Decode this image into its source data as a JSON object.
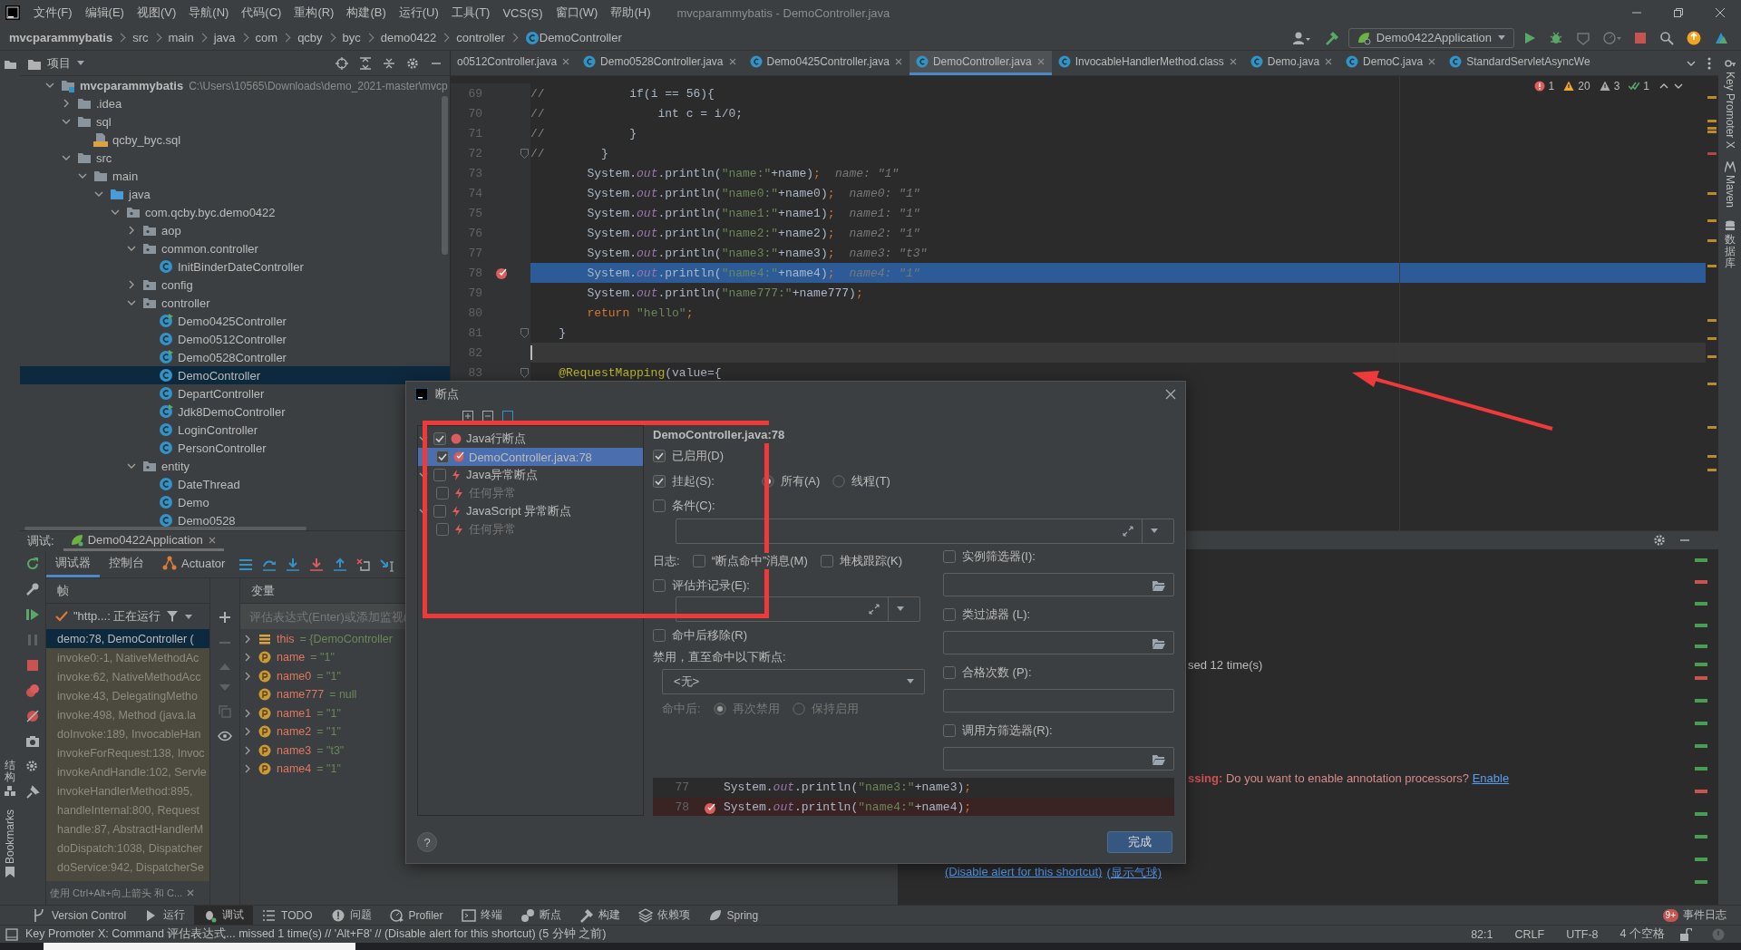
{
  "menu_bar": {
    "items": [
      "文件(F)",
      "编辑(E)",
      "视图(V)",
      "导航(N)",
      "代码(C)",
      "重构(R)",
      "构建(B)",
      "运行(U)",
      "工具(T)",
      "VCS(S)",
      "窗口(W)",
      "帮助(H)"
    ],
    "title": "mvcparammybatis - DemoController.java"
  },
  "nav_bar": {
    "breadcrumbs": [
      "mvcparammybatis",
      "src",
      "main",
      "java",
      "com",
      "qcby",
      "byc",
      "demo0422",
      "controller",
      "DemoController"
    ],
    "run_config": "Demo0422Application"
  },
  "left_stripe": [
    {
      "label": "结构",
      "kind": "stacked"
    },
    {
      "label": "Bookmarks",
      "kind": "rotated"
    }
  ],
  "right_stripe": [
    {
      "label": "Key Promoter X",
      "kind": "rotated"
    },
    {
      "label": "Maven",
      "kind": "rotated"
    },
    {
      "label": "数据库",
      "kind": "stacked"
    }
  ],
  "project_panel": {
    "title": "项目",
    "tree": [
      {
        "label": "mvcparammybatis",
        "path": "C:\\Users\\10565\\Downloads\\demo_2021-master\\mvcp",
        "kind": "module",
        "expanded": true,
        "selected": false,
        "children": [
          {
            "label": ".idea",
            "kind": "folder",
            "expanded": false,
            "selected": false
          },
          {
            "label": "sql",
            "kind": "folder",
            "expanded": true,
            "selected": false,
            "children": [
              {
                "label": "qcby_byc.sql",
                "kind": "sql",
                "selected": false
              }
            ]
          },
          {
            "label": "src",
            "kind": "folder",
            "expanded": true,
            "selected": false,
            "children": [
              {
                "label": "main",
                "kind": "folder",
                "expanded": true,
                "selected": false,
                "children": [
                  {
                    "label": "java",
                    "kind": "source",
                    "expanded": true,
                    "selected": false,
                    "children": [
                      {
                        "label": "com.qcby.byc.demo0422",
                        "kind": "package",
                        "expanded": true,
                        "selected": false,
                        "children": [
                          {
                            "label": "aop",
                            "kind": "package",
                            "expanded": false,
                            "selected": false
                          },
                          {
                            "label": "common.controller",
                            "kind": "package",
                            "expanded": true,
                            "selected": false,
                            "children": [
                              {
                                "label": "InitBinderDateController",
                                "kind": "class",
                                "runnable": false,
                                "selected": false
                              }
                            ]
                          },
                          {
                            "label": "config",
                            "kind": "package",
                            "expanded": false,
                            "selected": false
                          },
                          {
                            "label": "controller",
                            "kind": "package",
                            "expanded": true,
                            "selected": false,
                            "children": [
                              {
                                "label": "Demo0425Controller",
                                "kind": "class",
                                "runnable": true,
                                "selected": false
                              },
                              {
                                "label": "Demo0512Controller",
                                "kind": "class",
                                "runnable": false,
                                "selected": false
                              },
                              {
                                "label": "Demo0528Controller",
                                "kind": "class",
                                "runnable": true,
                                "selected": false
                              },
                              {
                                "label": "DemoController",
                                "kind": "class",
                                "runnable": false,
                                "selected": true
                              },
                              {
                                "label": "DepartController",
                                "kind": "class",
                                "runnable": false,
                                "selected": false
                              },
                              {
                                "label": "Jdk8DemoController",
                                "kind": "class",
                                "runnable": true,
                                "selected": false
                              },
                              {
                                "label": "LoginController",
                                "kind": "class",
                                "runnable": false,
                                "selected": false
                              },
                              {
                                "label": "PersonController",
                                "kind": "class",
                                "runnable": false,
                                "selected": false
                              }
                            ]
                          },
                          {
                            "label": "entity",
                            "kind": "package",
                            "expanded": true,
                            "selected": false,
                            "children": [
                              {
                                "label": "DateThread",
                                "kind": "class",
                                "runnable": false,
                                "selected": false
                              },
                              {
                                "label": "Demo",
                                "kind": "class",
                                "runnable": false,
                                "selected": false
                              },
                              {
                                "label": "Demo0528",
                                "kind": "class",
                                "runnable": false,
                                "selected": false
                              }
                            ]
                          }
                        ]
                      }
                    ]
                  }
                ]
              }
            ]
          }
        ]
      }
    ]
  },
  "editor": {
    "tabs": [
      {
        "label": "o0512Controller.java",
        "selected": false
      },
      {
        "label": "Demo0528Controller.java",
        "selected": false
      },
      {
        "label": "Demo0425Controller.java",
        "selected": false
      },
      {
        "label": "DemoController.java",
        "selected": true
      },
      {
        "label": "InvocableHandlerMethod.class",
        "selected": false
      },
      {
        "label": "Demo.java",
        "selected": false
      },
      {
        "label": "DemoC.java",
        "selected": false
      },
      {
        "label": "StandardServletAsyncWe",
        "selected": false
      }
    ],
    "inspections": [
      {
        "kind": "error",
        "count": "1"
      },
      {
        "kind": "warning",
        "count": "20"
      },
      {
        "kind": "weak",
        "count": "3"
      },
      {
        "kind": "ok",
        "count": "1"
      }
    ],
    "lines": [
      {
        "number": "69",
        "tokens": [
          {
            "text": "//",
            "kind": "comment"
          },
          {
            "text": "            if(i == 56){",
            "kind": "plain"
          }
        ],
        "breakpoint": false,
        "fold": false,
        "execution": false,
        "caret": false
      },
      {
        "number": "70",
        "tokens": [
          {
            "text": "//",
            "kind": "comment"
          },
          {
            "text": "                int c = i/0;",
            "kind": "plain"
          }
        ],
        "breakpoint": false,
        "fold": false,
        "execution": false,
        "caret": false
      },
      {
        "number": "71",
        "tokens": [
          {
            "text": "//",
            "kind": "comment"
          },
          {
            "text": "            }",
            "kind": "plain"
          }
        ],
        "breakpoint": false,
        "fold": false,
        "execution": false,
        "caret": false
      },
      {
        "number": "72",
        "tokens": [
          {
            "text": "//",
            "kind": "comment"
          },
          {
            "text": "        }",
            "kind": "plain"
          }
        ],
        "breakpoint": false,
        "fold": true,
        "execution": false,
        "caret": false
      },
      {
        "number": "73",
        "tokens": [
          {
            "text": "        System.",
            "kind": "plain"
          },
          {
            "text": "out",
            "kind": "field"
          },
          {
            "text": ".println(",
            "kind": "plain"
          },
          {
            "text": "\"name:\"",
            "kind": "string"
          },
          {
            "text": "+name)",
            "kind": "plain"
          },
          {
            "text": ";",
            "kind": "keyword"
          }
        ],
        "hint": "name: \"1\"",
        "breakpoint": false,
        "fold": false,
        "execution": false,
        "caret": false
      },
      {
        "number": "74",
        "tokens": [
          {
            "text": "        System.",
            "kind": "plain"
          },
          {
            "text": "out",
            "kind": "field"
          },
          {
            "text": ".println(",
            "kind": "plain"
          },
          {
            "text": "\"name0:\"",
            "kind": "string"
          },
          {
            "text": "+name0)",
            "kind": "plain"
          },
          {
            "text": ";",
            "kind": "keyword"
          }
        ],
        "hint": "name0: \"1\"",
        "breakpoint": false,
        "fold": false,
        "execution": false,
        "caret": false
      },
      {
        "number": "75",
        "tokens": [
          {
            "text": "        System.",
            "kind": "plain"
          },
          {
            "text": "out",
            "kind": "field"
          },
          {
            "text": ".println(",
            "kind": "plain"
          },
          {
            "text": "\"name1:\"",
            "kind": "string"
          },
          {
            "text": "+name1)",
            "kind": "plain"
          },
          {
            "text": ";",
            "kind": "keyword"
          }
        ],
        "hint": "name1: \"1\"",
        "breakpoint": false,
        "fold": false,
        "execution": false,
        "caret": false
      },
      {
        "number": "76",
        "tokens": [
          {
            "text": "        System.",
            "kind": "plain"
          },
          {
            "text": "out",
            "kind": "field"
          },
          {
            "text": ".println(",
            "kind": "plain"
          },
          {
            "text": "\"name2:\"",
            "kind": "string"
          },
          {
            "text": "+name2)",
            "kind": "plain"
          },
          {
            "text": ";",
            "kind": "keyword"
          }
        ],
        "hint": "name2: \"1\"",
        "breakpoint": false,
        "fold": false,
        "execution": false,
        "caret": false
      },
      {
        "number": "77",
        "tokens": [
          {
            "text": "        System.",
            "kind": "plain"
          },
          {
            "text": "out",
            "kind": "field"
          },
          {
            "text": ".println(",
            "kind": "plain"
          },
          {
            "text": "\"name3:\"",
            "kind": "string"
          },
          {
            "text": "+name3)",
            "kind": "plain"
          },
          {
            "text": ";",
            "kind": "keyword"
          }
        ],
        "hint": "name3: \"t3\"",
        "breakpoint": false,
        "fold": false,
        "execution": false,
        "caret": false
      },
      {
        "number": "78",
        "tokens": [
          {
            "text": "        System.",
            "kind": "plain"
          },
          {
            "text": "out",
            "kind": "field"
          },
          {
            "text": ".println(",
            "kind": "plain"
          },
          {
            "text": "\"name4:\"",
            "kind": "string"
          },
          {
            "text": "+name4)",
            "kind": "plain"
          },
          {
            "text": ";",
            "kind": "keyword"
          }
        ],
        "hint": "name4: \"1\"",
        "breakpoint": true,
        "fold": false,
        "execution": true,
        "caret": false
      },
      {
        "number": "79",
        "tokens": [
          {
            "text": "        System.",
            "kind": "plain"
          },
          {
            "text": "out",
            "kind": "field"
          },
          {
            "text": ".println(",
            "kind": "plain"
          },
          {
            "text": "\"name777:\"",
            "kind": "string"
          },
          {
            "text": "+name777)",
            "kind": "plain"
          },
          {
            "text": ";",
            "kind": "keyword"
          }
        ],
        "breakpoint": false,
        "fold": false,
        "execution": false,
        "caret": false
      },
      {
        "number": "80",
        "tokens": [
          {
            "text": "        return ",
            "kind": "keyword"
          },
          {
            "text": "\"hello\"",
            "kind": "string"
          },
          {
            "text": ";",
            "kind": "keyword"
          }
        ],
        "breakpoint": false,
        "fold": false,
        "execution": false,
        "caret": false
      },
      {
        "number": "81",
        "tokens": [
          {
            "text": "    }",
            "kind": "plain"
          }
        ],
        "breakpoint": false,
        "fold": true,
        "execution": false,
        "caret": false
      },
      {
        "number": "82",
        "breakpoint": false,
        "fold": false,
        "execution": false,
        "caret": true
      },
      {
        "number": "83",
        "tokens": [
          {
            "text": "    @RequestMapping",
            "kind": "annotation"
          },
          {
            "text": "(value={",
            "kind": "plain"
          }
        ],
        "breakpoint": false,
        "fold": true,
        "execution": false,
        "caret": false
      }
    ]
  },
  "debug_panel": {
    "label": "调试:",
    "session": "Demo0422Application",
    "tabs": [
      {
        "label": "调试器",
        "selected": true
      },
      {
        "label": "控制台",
        "selected": false
      },
      {
        "label": "Actuator",
        "selected": false
      }
    ],
    "frames_title": "帧",
    "variables_title": "变量",
    "thread": "\"http...: 正在运行",
    "frames": [
      {
        "text": "demo:78, DemoController (",
        "selected": true
      },
      {
        "text": "invoke0:-1, NativeMethodAc",
        "selected": false
      },
      {
        "text": "invoke:62, NativeMethodAcc",
        "selected": false
      },
      {
        "text": "invoke:43, DelegatingMetho",
        "selected": false
      },
      {
        "text": "invoke:498, Method (java.la",
        "selected": false
      },
      {
        "text": "doInvoke:189, InvocableHan",
        "selected": false
      },
      {
        "text": "invokeForRequest:138, Invoc",
        "selected": false
      },
      {
        "text": "invokeAndHandle:102, Servle",
        "selected": false
      },
      {
        "text": "invokeHandlerMethod:895,",
        "selected": false
      },
      {
        "text": "handleInternal:800, Request",
        "selected": false
      },
      {
        "text": "handle:87, AbstractHandlerM",
        "selected": false
      },
      {
        "text": "doDispatch:1038, Dispatcher",
        "selected": false
      },
      {
        "text": "doService:942, DispatcherSe",
        "selected": false
      }
    ],
    "hint": "使用 Ctrl+Alt+向上箭头 和 C...",
    "watch_placeholder": "评估表达式(Enter)或添加监视(",
    "variables": [
      {
        "name": "this",
        "value": "= {DemoController",
        "kind": "object",
        "expandable": true
      },
      {
        "name": "name",
        "value": "= \"1\"",
        "kind": "field",
        "expandable": true
      },
      {
        "name": "name0",
        "value": "= \"1\"",
        "kind": "field",
        "expandable": true
      },
      {
        "name": "name777",
        "value": "= null",
        "kind": "field",
        "expandable": false
      },
      {
        "name": "name1",
        "value": "= \"1\"",
        "kind": "field",
        "expandable": true
      },
      {
        "name": "name2",
        "value": "= \"1\"",
        "kind": "field",
        "expandable": true
      },
      {
        "name": "name3",
        "value": "= \"t3\"",
        "kind": "field",
        "expandable": true
      },
      {
        "name": "name4",
        "value": "= \"1\"",
        "kind": "field",
        "expandable": true
      }
    ]
  },
  "console": {
    "lines": [
      {
        "kind": "info",
        "text": "sed 12 time(s)"
      },
      {
        "kind": "error",
        "text": "**ssing:** Do you want to enable annotation processors?",
        "link": "Enable"
      },
      {
        "kind": "links",
        "links": [
          "(Disable alert for this shortcut)",
          "(显示气球)"
        ]
      }
    ]
  },
  "tool_strip": {
    "items": [
      {
        "label": "Version Control",
        "selected": false
      },
      {
        "label": "运行",
        "selected": false
      },
      {
        "label": "调试",
        "selected": true
      },
      {
        "label": "TODO",
        "selected": false
      },
      {
        "label": "问题",
        "selected": false
      },
      {
        "label": "Profiler",
        "selected": false
      },
      {
        "label": "终端",
        "selected": false
      },
      {
        "label": "断点",
        "selected": false
      },
      {
        "label": "构建",
        "selected": false
      },
      {
        "label": "依赖项",
        "selected": false
      },
      {
        "label": "Spring",
        "selected": false
      }
    ],
    "event_log": {
      "badge": "9+",
      "label": "事件日志"
    }
  },
  "status_bar": {
    "message": "Key Promoter X: Command 评估表达式... missed 1 time(s) // 'Alt+F8' // (Disable alert for this shortcut) (5 分钟 之前)",
    "items": [
      "82:1",
      "CRLF",
      "UTF-8",
      "4 个空格"
    ]
  },
  "dialog": {
    "title": "断点",
    "tree": [
      {
        "label": "Java行断点",
        "kind": "line",
        "checked": true,
        "selected": false,
        "children": [
          {
            "label": "DemoController.java:78",
            "kind": "line_item",
            "checked": true,
            "selected": true
          }
        ]
      },
      {
        "label": "Java异常断点",
        "kind": "exception",
        "checked": false,
        "selected": false,
        "children": [
          {
            "label": "任何异常",
            "kind": "exception_item",
            "checked": false,
            "selected": false
          }
        ]
      },
      {
        "label": "JavaScript 异常断点",
        "kind": "exception",
        "checked": false,
        "selected": false,
        "children": [
          {
            "label": "任何异常",
            "kind": "exception_item",
            "checked": false,
            "selected": false
          }
        ]
      }
    ],
    "heading": "DemoController.java:78",
    "enabled": {
      "label": "已启用(D)",
      "checked": true
    },
    "suspend": {
      "label": "挂起(S):",
      "checked": true,
      "options": [
        {
          "label": "所有(A)",
          "selected": true
        },
        {
          "label": "线程(T)",
          "selected": false
        }
      ]
    },
    "condition": {
      "label": "条件(C):",
      "checked": false
    },
    "log_label": "日志:",
    "log_options": [
      {
        "label": "“断点命中”消息(M)",
        "checked": false
      },
      {
        "label": "堆栈跟踪(K)",
        "checked": false
      }
    ],
    "evaluate": {
      "label": "评估并记录(E):",
      "checked": false
    },
    "remove": {
      "label": "命中后移除(R)",
      "checked": false
    },
    "disable_label": "禁用，直至命中以下断点:",
    "disable_select": "<无>",
    "after_hit": {
      "label": "命中后:",
      "disabled": true,
      "options": [
        {
          "label": "再次禁用",
          "selected": true
        },
        {
          "label": "保持启用",
          "selected": false
        }
      ]
    },
    "filters": [
      {
        "label": "实例筛选器(I):",
        "checked": false,
        "kind": "browse"
      },
      {
        "label": "类过滤器 (L):",
        "checked": false,
        "kind": "browse"
      },
      {
        "label": "合格次数 (P):",
        "checked": false,
        "kind": "plain"
      },
      {
        "label": "调用方筛选器(R):",
        "checked": false,
        "kind": "browse"
      }
    ],
    "preview": [
      {
        "number": "77",
        "tokens": [
          {
            "text": "System.",
            "kind": "plain"
          },
          {
            "text": "out",
            "kind": "field"
          },
          {
            "text": ".println(",
            "kind": "plain"
          },
          {
            "text": "\"name3:\"",
            "kind": "string"
          },
          {
            "text": "+name3)",
            "kind": "plain"
          },
          {
            "text": ";",
            "kind": "keyword"
          }
        ],
        "breakpoint": false
      },
      {
        "number": "78",
        "tokens": [
          {
            "text": "System.",
            "kind": "plain"
          },
          {
            "text": "out",
            "kind": "field"
          },
          {
            "text": ".println(",
            "kind": "plain"
          },
          {
            "text": "\"name4:\"",
            "kind": "string"
          },
          {
            "text": "+name4)",
            "kind": "plain"
          },
          {
            "text": ";",
            "kind": "keyword"
          }
        ],
        "breakpoint": true
      }
    ],
    "help": "?",
    "done": "完成"
  }
}
